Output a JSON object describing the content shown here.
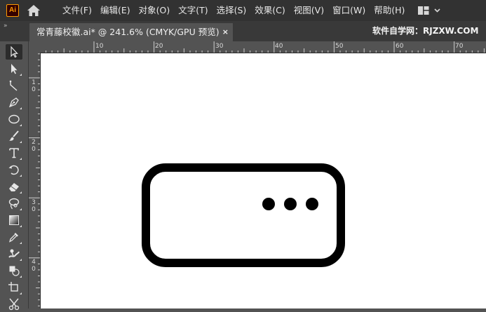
{
  "app": {
    "logo_text": "Ai",
    "menu": [
      "文件(F)",
      "编辑(E)",
      "对象(O)",
      "文字(T)",
      "选择(S)",
      "效果(C)",
      "视图(V)",
      "窗口(W)",
      "帮助(H)"
    ]
  },
  "tabbar": {
    "collapse_glyph": "»",
    "document_title": "常青藤校徽.ai* @ 241.6% (CMYK/GPU 预览)",
    "close_glyph": "×",
    "watermark": "软件自学网：RJZXW.COM"
  },
  "toolbar": {
    "tools": [
      {
        "name": "selection-tool",
        "icon": "selection-arrow-icon",
        "active": true
      },
      {
        "name": "direct-selection-tool",
        "icon": "direct-selection-icon"
      },
      {
        "name": "curvature-tool",
        "icon": "curvature-icon"
      },
      {
        "name": "pen-tool",
        "icon": "pen-icon"
      },
      {
        "name": "ellipse-tool",
        "icon": "ellipse-icon"
      },
      {
        "name": "paintbrush-tool",
        "icon": "paintbrush-icon"
      },
      {
        "name": "type-tool",
        "icon": "type-icon"
      },
      {
        "name": "rotate-tool",
        "icon": "rotate-icon"
      },
      {
        "name": "eraser-tool",
        "icon": "eraser-icon"
      },
      {
        "name": "lasso-tool",
        "icon": "lasso-icon"
      },
      {
        "name": "gradient-tool",
        "icon": "gradient-icon"
      },
      {
        "name": "eyedropper-tool",
        "icon": "eyedropper-icon"
      },
      {
        "name": "puppet-warp-tool",
        "icon": "puppet-warp-icon"
      },
      {
        "name": "shape-builder-tool",
        "icon": "shape-builder-icon"
      },
      {
        "name": "artboard-tool",
        "icon": "artboard-icon"
      },
      {
        "name": "scissors-tool",
        "icon": "scissors-icon"
      }
    ]
  },
  "rulers": {
    "horizontal_labels": [
      "10",
      "20",
      "30",
      "40",
      "50",
      "60",
      "70"
    ],
    "vertical_labels": [
      "1\n0",
      "2\n0",
      "3\n0",
      "4\n0"
    ]
  },
  "artwork": {
    "stroke_color": "#000000",
    "dot_count": 3
  }
}
